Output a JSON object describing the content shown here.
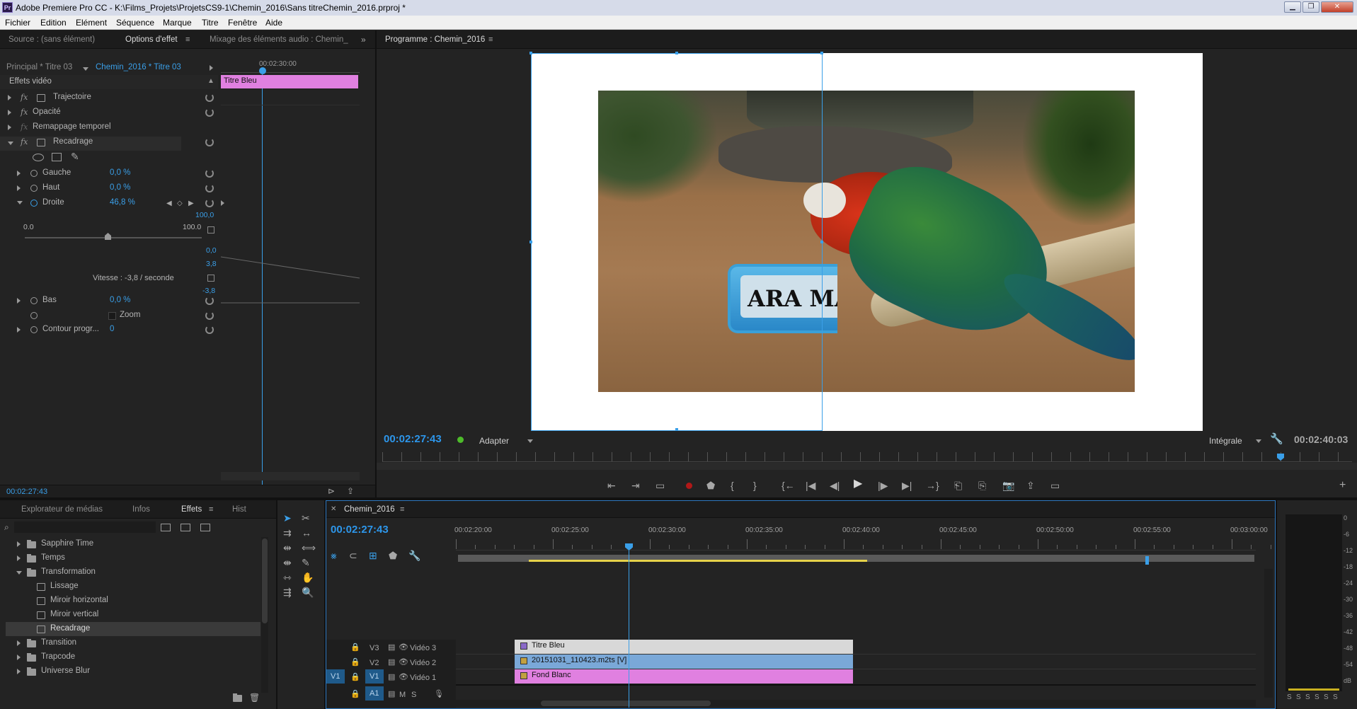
{
  "titlebar": {
    "app_icon": "Pr",
    "title": "Adobe Premiere Pro CC - K:\\Films_Projets\\ProjetsCS9-1\\Chemin_2016\\Sans titreChemin_2016.prproj *"
  },
  "menu": [
    "Fichier",
    "Edition",
    "Elément",
    "Séquence",
    "Marque",
    "Titre",
    "Fenêtre",
    "Aide"
  ],
  "effect_panel": {
    "tabs": [
      "Source : (sans élément)",
      "Options d'effet",
      "Mixage des éléments audio : Chemin_"
    ],
    "master_label": "Principal * Titre 03",
    "sequence_label": "Chemin_2016 * Titre 03",
    "mini_timecode": "00:02:30:00",
    "clip_name": "Titre Bleu",
    "section": "Effets vidéo",
    "effects": [
      "Trajectoire",
      "Opacité",
      "Remappage temporel",
      "Recadrage"
    ],
    "params": {
      "gauche": {
        "label": "Gauche",
        "value": "0,0 %"
      },
      "haut": {
        "label": "Haut",
        "value": "0,0 %"
      },
      "droite": {
        "label": "Droite",
        "value": "46,8 %"
      },
      "bas": {
        "label": "Bas",
        "value": "0,0 %"
      },
      "zoom": {
        "label": "Zoom"
      },
      "contour": {
        "label": "Contour progr...",
        "value": "0"
      }
    },
    "slider_min": "0.0",
    "slider_max": "100.0",
    "slider_value_pct": 46.8,
    "graph_labels": [
      "100,0",
      "0,0",
      "3,8",
      "-3,8"
    ],
    "speed_label": "Vitesse : -3,8 / seconde",
    "timecode": "00:02:27:43"
  },
  "program": {
    "title": "Programme : Chemin_2016",
    "timecode": "00:02:27:43",
    "fit": "Adapter",
    "quality": "Intégrale",
    "duration": "00:02:40:03",
    "overlay_text": "ARA MA"
  },
  "project_panel": {
    "tabs": [
      "Explorateur de médias",
      "Infos",
      "Effets",
      "Hist"
    ],
    "items": [
      {
        "label": "Sapphire Time",
        "type": "folder",
        "open": false
      },
      {
        "label": "Temps",
        "type": "folder",
        "open": false
      },
      {
        "label": "Transformation",
        "type": "folder",
        "open": true
      },
      {
        "label": "Lissage",
        "type": "effect"
      },
      {
        "label": "Miroir horizontal",
        "type": "effect"
      },
      {
        "label": "Miroir vertical",
        "type": "effect"
      },
      {
        "label": "Recadrage",
        "type": "effect",
        "selected": true
      },
      {
        "label": "Transition",
        "type": "folder",
        "open": false
      },
      {
        "label": "Trapcode",
        "type": "folder",
        "open": false
      },
      {
        "label": "Universe Blur",
        "type": "folder",
        "open": false
      }
    ]
  },
  "timeline": {
    "tab": "Chemin_2016",
    "timecode": "00:02:27:43",
    "ruler": [
      "00:02:20:00",
      "00:02:25:00",
      "00:02:30:00",
      "00:02:35:00",
      "00:02:40:00",
      "00:02:45:00",
      "00:02:50:00",
      "00:02:55:00",
      "00:03:00:00"
    ],
    "tracks": [
      {
        "id": "V3",
        "name": "Vidéo 3",
        "clip": "Titre Bleu",
        "color": "#d8d8d8"
      },
      {
        "id": "V2",
        "name": "Vidéo 2",
        "clip": "20151031_110423.m2ts [V]",
        "color": "#7aa8d8"
      },
      {
        "id": "V1",
        "name": "Vidéo 1",
        "clip": "Fond Blanc",
        "color": "#e080e0",
        "src": "V1"
      }
    ],
    "audio": {
      "id": "A1",
      "m": "M",
      "s": "S"
    }
  },
  "meter": {
    "scale": [
      "0",
      "-6",
      "-12",
      "-18",
      "-24",
      "-30",
      "-36",
      "-42",
      "-48",
      "-54",
      "dB"
    ],
    "solo": [
      "S",
      "S",
      "S",
      "S",
      "S",
      "S"
    ]
  }
}
